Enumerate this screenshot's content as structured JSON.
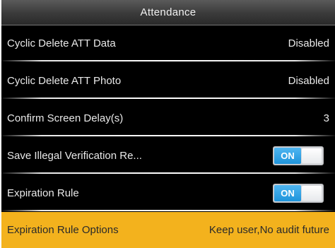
{
  "header": {
    "title": "Attendance"
  },
  "rows": [
    {
      "label": "Cyclic Delete ATT Data",
      "value": "Disabled"
    },
    {
      "label": "Cyclic Delete ATT Photo",
      "value": "Disabled"
    },
    {
      "label": "Confirm Screen Delay(s)",
      "value": "3"
    },
    {
      "label": "Save Illegal Verification Re...",
      "toggle": "ON"
    },
    {
      "label": "Expiration Rule",
      "toggle": "ON"
    },
    {
      "label": "Expiration Rule Options",
      "value": "Keep user,No audit future"
    }
  ],
  "colors": {
    "selected_row": "#f3b21d",
    "toggle_on": "#1f94db",
    "background": "#000000"
  }
}
